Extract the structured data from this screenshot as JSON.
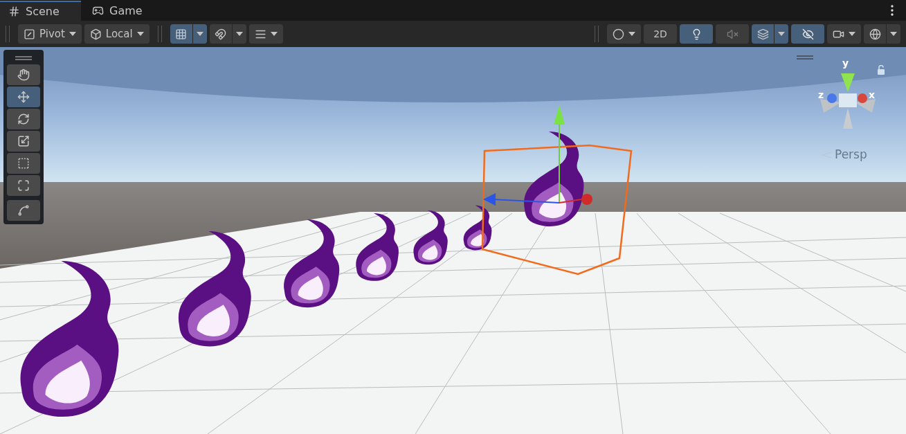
{
  "tabs": [
    {
      "label": "Scene",
      "selected": true
    },
    {
      "label": "Game",
      "selected": false
    }
  ],
  "toolbar_left": [
    {
      "kind": "dropdown",
      "label": "Pivot"
    },
    {
      "kind": "dropdown",
      "label": "Local"
    },
    {
      "kind": "split",
      "on": true
    },
    {
      "kind": "split",
      "on": false
    },
    {
      "kind": "dropdown"
    }
  ],
  "toolbar_right": [
    {
      "kind": "dropdown",
      "on": false
    },
    {
      "kind": "text",
      "label": "2D",
      "on": false
    },
    {
      "kind": "icon",
      "on": true
    },
    {
      "kind": "icon",
      "on": false
    },
    {
      "kind": "split",
      "on": true
    },
    {
      "kind": "icon",
      "on": true
    },
    {
      "kind": "dropdown",
      "on": false
    },
    {
      "kind": "split",
      "on": false
    }
  ],
  "tools": [
    {
      "selected": false
    },
    {
      "selected": true
    },
    {
      "selected": false
    },
    {
      "selected": false
    },
    {
      "selected": false
    },
    {
      "selected": false
    },
    {
      "selected": false
    }
  ],
  "orientation_gizmo": {
    "y_label": "y",
    "z_label": "z",
    "x_label": "x",
    "projection": "Persp"
  }
}
